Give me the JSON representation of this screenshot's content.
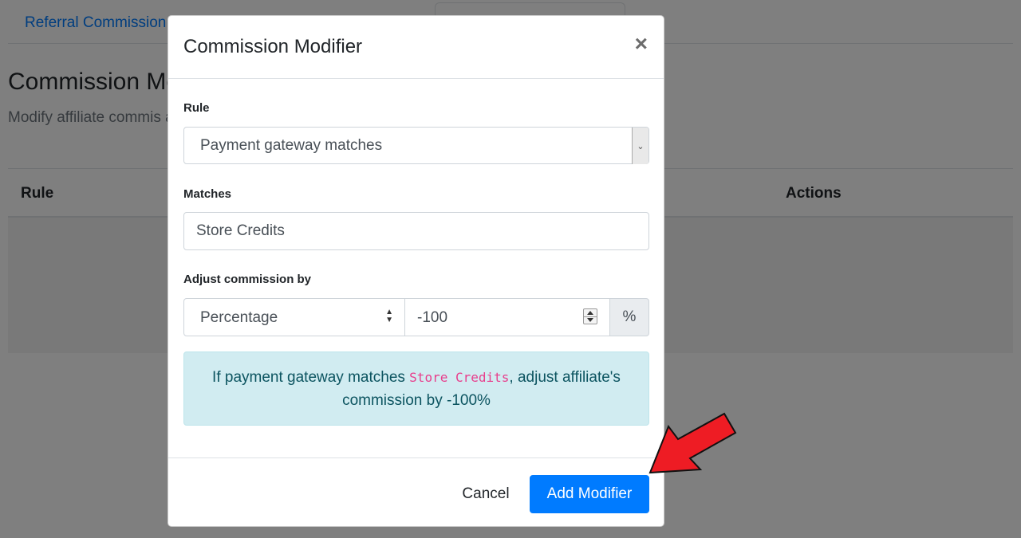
{
  "background": {
    "tab_label": "Referral Commission",
    "heading": "Commission Mo",
    "description": "Modify affiliate commis advanced users only.",
    "table": {
      "col_rule": "Rule",
      "col_actions": "Actions"
    }
  },
  "modal": {
    "title": "Commission Modifier",
    "close_glyph": "×",
    "rule": {
      "label": "Rule",
      "selected": "Payment gateway matches"
    },
    "matches": {
      "label": "Matches",
      "value": "Store Credits"
    },
    "adjust": {
      "label": "Adjust commission by",
      "type_selected": "Percentage",
      "amount": "-100",
      "unit": "%"
    },
    "summary": {
      "prefix": "If payment gateway matches ",
      "code": "Store Credits",
      "suffix": ", adjust affiliate's commission by -100%"
    },
    "footer": {
      "cancel_label": "Cancel",
      "add_label": "Add Modifier"
    }
  },
  "colors": {
    "primary": "#007bff",
    "alert_bg": "#d1ecf1",
    "alert_text": "#0c5460",
    "code_pink": "#e83e8c",
    "arrow_red": "#ee1c24"
  },
  "icons": {
    "select_arrow": "chevron-down-icon",
    "updown": "sort-arrows-icon",
    "close": "close-icon",
    "annotation": "red-arrow-icon"
  }
}
